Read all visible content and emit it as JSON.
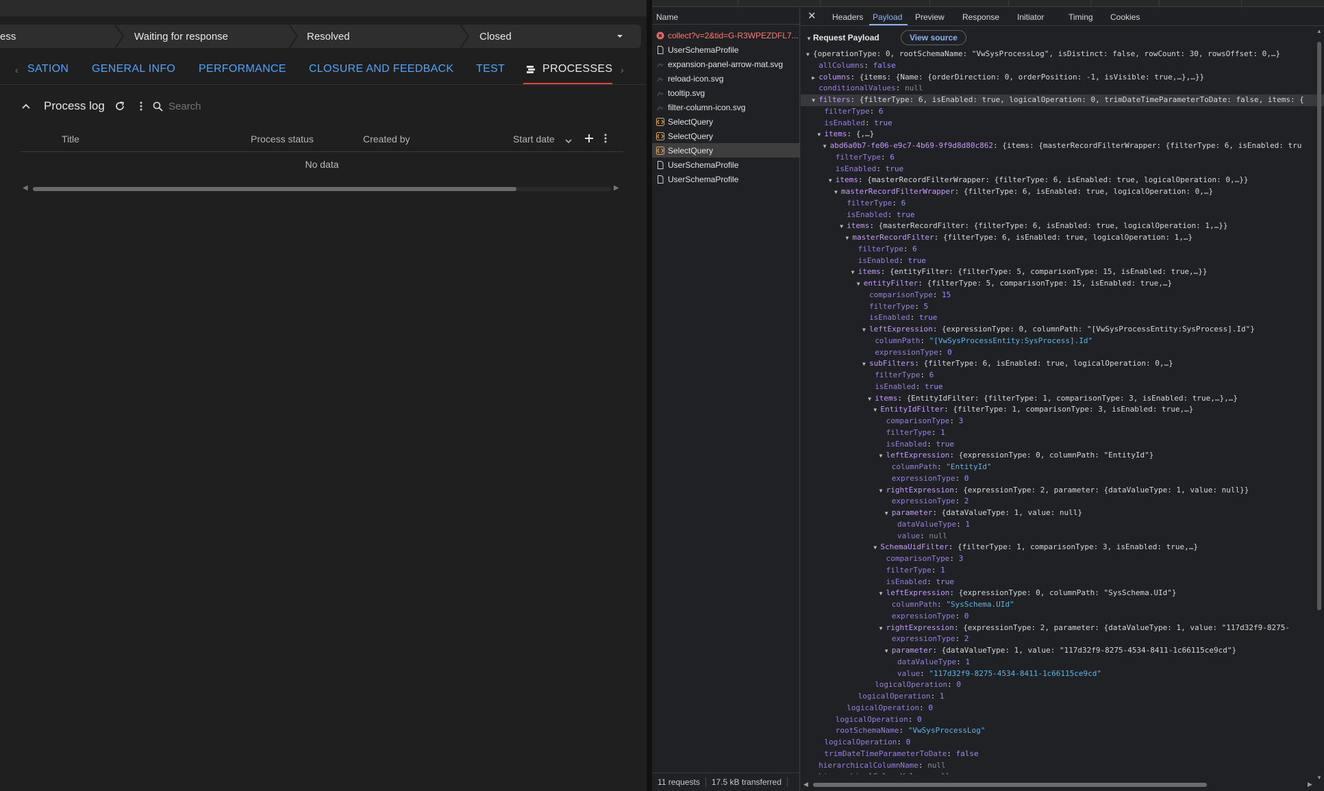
{
  "app": {
    "stages": [
      "ess",
      "Waiting for response",
      "Resolved",
      "Closed"
    ],
    "tabs": [
      {
        "label": "SATION",
        "active": false
      },
      {
        "label": "GENERAL INFO",
        "active": false
      },
      {
        "label": "PERFORMANCE",
        "active": false
      },
      {
        "label": "CLOSURE AND FEEDBACK",
        "active": false
      },
      {
        "label": "TEST",
        "active": false
      },
      {
        "label": "PROCESSES",
        "active": true
      }
    ],
    "process_log": {
      "title": "Process log",
      "search_placeholder": "Search",
      "columns": [
        "Title",
        "Process status",
        "Created by",
        "Start date"
      ],
      "empty_text": "No data"
    },
    "colors": {
      "link_tab": "#4ea3ff",
      "active_underline": "#d9473a",
      "background": "#1f1f1f"
    }
  },
  "devtools": {
    "requests_header": "Name",
    "requests": [
      {
        "name": "collect?v=2&tid=G-R3WPEZDFL7...",
        "type": "error"
      },
      {
        "name": "UserSchemaProfile",
        "type": "doc"
      },
      {
        "name": "expansion-panel-arrow-mat.svg",
        "type": "img"
      },
      {
        "name": "reload-icon.svg",
        "type": "img"
      },
      {
        "name": "tooltip.svg",
        "type": "img"
      },
      {
        "name": "filter-column-icon.svg",
        "type": "img"
      },
      {
        "name": "SelectQuery",
        "type": "xhr"
      },
      {
        "name": "SelectQuery",
        "type": "xhr"
      },
      {
        "name": "SelectQuery",
        "type": "xhr",
        "selected": true
      },
      {
        "name": "UserSchemaProfile",
        "type": "doc"
      },
      {
        "name": "UserSchemaProfile",
        "type": "doc"
      }
    ],
    "footer": {
      "requests": "11 requests",
      "transferred": "17.5 kB transferred"
    },
    "detail_tabs": [
      "Headers",
      "Payload",
      "Preview",
      "Response",
      "Initiator",
      "Timing",
      "Cookies"
    ],
    "active_detail_tab": "Payload",
    "payload_title": "Request Payload",
    "view_source_label": "View source",
    "tree": [
      {
        "d": 0,
        "t": "open",
        "k": "",
        "v": "{operationType: 0, rootSchemaName: \"VwSysProcessLog\", isDistinct: false, rowCount: 30, rowsOffset: 0,…}"
      },
      {
        "d": 1,
        "t": "leaf",
        "k": "allColumns",
        "v": "false",
        "vt": "b"
      },
      {
        "d": 1,
        "t": "closed",
        "k": "columns",
        "v": "{items: {Name: {orderDirection: 0, orderPosition: -1, isVisible: true,…},…}}"
      },
      {
        "d": 1,
        "t": "leaf",
        "k": "conditionalValues",
        "v": "null",
        "vt": "nl"
      },
      {
        "d": 1,
        "t": "open",
        "k": "filters",
        "v": "{filterType: 6, isEnabled: true, logicalOperation: 0, trimDateTimeParameterToDate: false, items: {",
        "hl": true
      },
      {
        "d": 2,
        "t": "leaf",
        "k": "filterType",
        "v": "6",
        "vt": "n"
      },
      {
        "d": 2,
        "t": "leaf",
        "k": "isEnabled",
        "v": "true",
        "vt": "b"
      },
      {
        "d": 2,
        "t": "open",
        "k": "items",
        "v": "{,…}"
      },
      {
        "d": 3,
        "t": "open",
        "k": "abd6a0b7-fe06-e9c7-4b69-9f9d8d80c862",
        "v": "{items: {masterRecordFilterWrapper: {filterType: 6, isEnabled: tru"
      },
      {
        "d": 4,
        "t": "leaf",
        "k": "filterType",
        "v": "6",
        "vt": "n"
      },
      {
        "d": 4,
        "t": "leaf",
        "k": "isEnabled",
        "v": "true",
        "vt": "b"
      },
      {
        "d": 4,
        "t": "open",
        "k": "items",
        "v": "{masterRecordFilterWrapper: {filterType: 6, isEnabled: true, logicalOperation: 0,…}}"
      },
      {
        "d": 5,
        "t": "open",
        "k": "masterRecordFilterWrapper",
        "v": "{filterType: 6, isEnabled: true, logicalOperation: 0,…}"
      },
      {
        "d": 6,
        "t": "leaf",
        "k": "filterType",
        "v": "6",
        "vt": "n"
      },
      {
        "d": 6,
        "t": "leaf",
        "k": "isEnabled",
        "v": "true",
        "vt": "b"
      },
      {
        "d": 6,
        "t": "open",
        "k": "items",
        "v": "{masterRecordFilter: {filterType: 6, isEnabled: true, logicalOperation: 1,…}}"
      },
      {
        "d": 7,
        "t": "open",
        "k": "masterRecordFilter",
        "v": "{filterType: 6, isEnabled: true, logicalOperation: 1,…}"
      },
      {
        "d": 8,
        "t": "leaf",
        "k": "filterType",
        "v": "6",
        "vt": "n"
      },
      {
        "d": 8,
        "t": "leaf",
        "k": "isEnabled",
        "v": "true",
        "vt": "b"
      },
      {
        "d": 8,
        "t": "open",
        "k": "items",
        "v": "{entityFilter: {filterType: 5, comparisonType: 15, isEnabled: true,…}}"
      },
      {
        "d": 9,
        "t": "open",
        "k": "entityFilter",
        "v": "{filterType: 5, comparisonType: 15, isEnabled: true,…}"
      },
      {
        "d": 10,
        "t": "leaf",
        "k": "comparisonType",
        "v": "15",
        "vt": "n"
      },
      {
        "d": 10,
        "t": "leaf",
        "k": "filterType",
        "v": "5",
        "vt": "n"
      },
      {
        "d": 10,
        "t": "leaf",
        "k": "isEnabled",
        "v": "true",
        "vt": "b"
      },
      {
        "d": 10,
        "t": "open",
        "k": "leftExpression",
        "v": "{expressionType: 0, columnPath: \"[VwSysProcessEntity:SysProcess].Id\"}"
      },
      {
        "d": 11,
        "t": "leaf",
        "k": "columnPath",
        "v": "\"[VwSysProcessEntity:SysProcess].Id\"",
        "vt": "s"
      },
      {
        "d": 11,
        "t": "leaf",
        "k": "expressionType",
        "v": "0",
        "vt": "n"
      },
      {
        "d": 10,
        "t": "open",
        "k": "subFilters",
        "v": "{filterType: 6, isEnabled: true, logicalOperation: 0,…}"
      },
      {
        "d": 11,
        "t": "leaf",
        "k": "filterType",
        "v": "6",
        "vt": "n"
      },
      {
        "d": 11,
        "t": "leaf",
        "k": "isEnabled",
        "v": "true",
        "vt": "b"
      },
      {
        "d": 11,
        "t": "open",
        "k": "items",
        "v": "{EntityIdFilter: {filterType: 1, comparisonType: 3, isEnabled: true,…},…}"
      },
      {
        "d": 12,
        "t": "open",
        "k": "EntityIdFilter",
        "v": "{filterType: 1, comparisonType: 3, isEnabled: true,…}"
      },
      {
        "d": 13,
        "t": "leaf",
        "k": "comparisonType",
        "v": "3",
        "vt": "n"
      },
      {
        "d": 13,
        "t": "leaf",
        "k": "filterType",
        "v": "1",
        "vt": "n"
      },
      {
        "d": 13,
        "t": "leaf",
        "k": "isEnabled",
        "v": "true",
        "vt": "b"
      },
      {
        "d": 13,
        "t": "open",
        "k": "leftExpression",
        "v": "{expressionType: 0, columnPath: \"EntityId\"}"
      },
      {
        "d": 14,
        "t": "leaf",
        "k": "columnPath",
        "v": "\"EntityId\"",
        "vt": "s"
      },
      {
        "d": 14,
        "t": "leaf",
        "k": "expressionType",
        "v": "0",
        "vt": "n"
      },
      {
        "d": 13,
        "t": "open",
        "k": "rightExpression",
        "v": "{expressionType: 2, parameter: {dataValueType: 1, value: null}}"
      },
      {
        "d": 14,
        "t": "leaf",
        "k": "expressionType",
        "v": "2",
        "vt": "n"
      },
      {
        "d": 14,
        "t": "open",
        "k": "parameter",
        "v": "{dataValueType: 1, value: null}"
      },
      {
        "d": 15,
        "t": "leaf",
        "k": "dataValueType",
        "v": "1",
        "vt": "n"
      },
      {
        "d": 15,
        "t": "leaf",
        "k": "value",
        "v": "null",
        "vt": "nl"
      },
      {
        "d": 12,
        "t": "open",
        "k": "SchemaUidFilter",
        "v": "{filterType: 1, comparisonType: 3, isEnabled: true,…}"
      },
      {
        "d": 13,
        "t": "leaf",
        "k": "comparisonType",
        "v": "3",
        "vt": "n"
      },
      {
        "d": 13,
        "t": "leaf",
        "k": "filterType",
        "v": "1",
        "vt": "n"
      },
      {
        "d": 13,
        "t": "leaf",
        "k": "isEnabled",
        "v": "true",
        "vt": "b"
      },
      {
        "d": 13,
        "t": "open",
        "k": "leftExpression",
        "v": "{expressionType: 0, columnPath: \"SysSchema.UId\"}"
      },
      {
        "d": 14,
        "t": "leaf",
        "k": "columnPath",
        "v": "\"SysSchema.UId\"",
        "vt": "s"
      },
      {
        "d": 14,
        "t": "leaf",
        "k": "expressionType",
        "v": "0",
        "vt": "n"
      },
      {
        "d": 13,
        "t": "open",
        "k": "rightExpression",
        "v": "{expressionType: 2, parameter: {dataValueType: 1, value: \"117d32f9-8275-"
      },
      {
        "d": 14,
        "t": "leaf",
        "k": "expressionType",
        "v": "2",
        "vt": "n"
      },
      {
        "d": 14,
        "t": "open",
        "k": "parameter",
        "v": "{dataValueType: 1, value: \"117d32f9-8275-4534-8411-1c66115ce9cd\"}"
      },
      {
        "d": 15,
        "t": "leaf",
        "k": "dataValueType",
        "v": "1",
        "vt": "n"
      },
      {
        "d": 15,
        "t": "leaf",
        "k": "value",
        "v": "\"117d32f9-8275-4534-8411-1c66115ce9cd\"",
        "vt": "s"
      },
      {
        "d": 11,
        "t": "leaf",
        "k": "logicalOperation",
        "v": "0",
        "vt": "n"
      },
      {
        "d": 8,
        "t": "leaf",
        "k": "logicalOperation",
        "v": "1",
        "vt": "n"
      },
      {
        "d": 6,
        "t": "leaf",
        "k": "logicalOperation",
        "v": "0",
        "vt": "n"
      },
      {
        "d": 4,
        "t": "leaf",
        "k": "logicalOperation",
        "v": "0",
        "vt": "n"
      },
      {
        "d": 4,
        "t": "leaf",
        "k": "rootSchemaName",
        "v": "\"VwSysProcessLog\"",
        "vt": "s"
      },
      {
        "d": 2,
        "t": "leaf",
        "k": "logicalOperation",
        "v": "0",
        "vt": "n"
      },
      {
        "d": 2,
        "t": "leaf",
        "k": "trimDateTimeParameterToDate",
        "v": "false",
        "vt": "b"
      },
      {
        "d": 1,
        "t": "leaf",
        "k": "hierarchicalColumnName",
        "v": "null",
        "vt": "nl"
      },
      {
        "d": 1,
        "t": "leaf",
        "k": "hierarchicalColumnValue",
        "v": "null",
        "vt": "nl"
      }
    ]
  }
}
